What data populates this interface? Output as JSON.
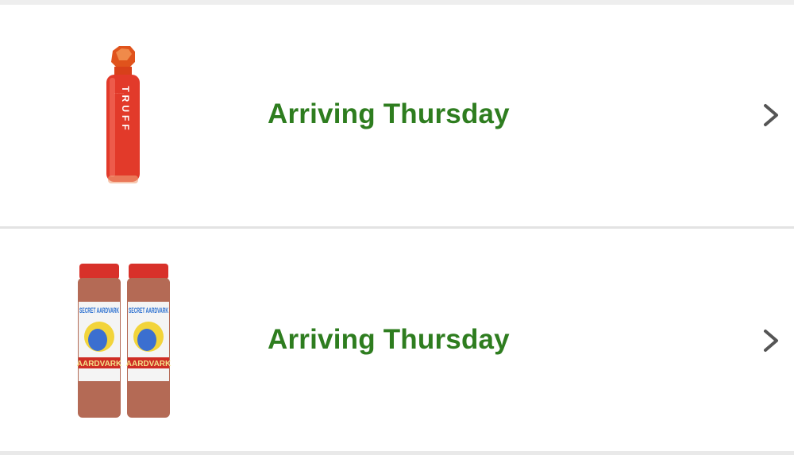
{
  "orders": [
    {
      "status": "Arriving Thursday",
      "product_icon": "hot-sauce-bottle-icon",
      "bottle_label": "TRUFF"
    },
    {
      "status": "Arriving Thursday",
      "product_icon": "hot-sauce-two-pack-icon",
      "bottle_brand": "SECRET AARDVARK",
      "bottle_label": "AARDVARK"
    }
  ],
  "colors": {
    "status_green": "#2e7d1f",
    "chevron": "#555555",
    "divider": "#e3e3e3"
  },
  "icons": {
    "row_action": "chevron-right-icon"
  }
}
